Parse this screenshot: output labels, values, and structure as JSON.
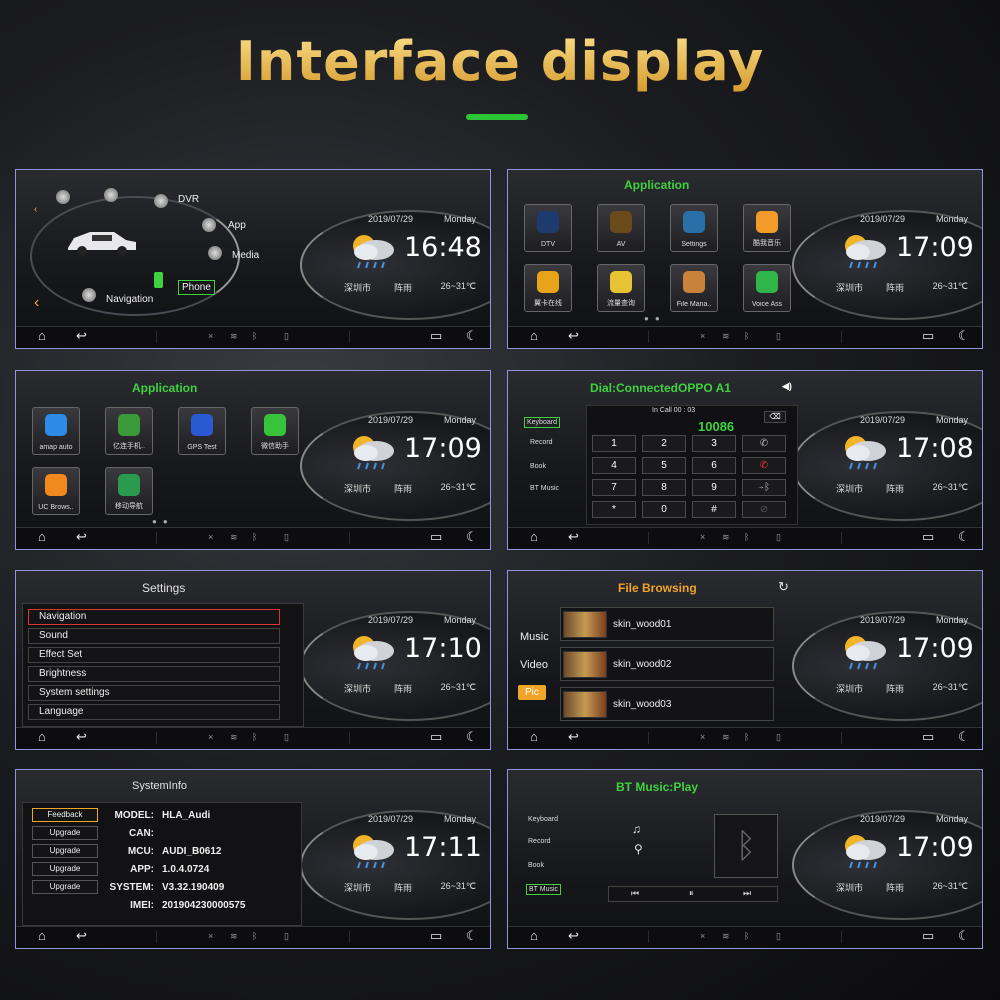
{
  "header": {
    "title": "Interface display"
  },
  "widget": {
    "date": "2019/07/29",
    "day": "Monday",
    "city": "深圳市",
    "condition": "阵雨",
    "temp": "26~31℃"
  },
  "times": [
    "16:48",
    "17:09",
    "17:09",
    "17:08",
    "17:10",
    "17:09",
    "17:11",
    "17:09"
  ],
  "home": {
    "items": {
      "dvr": "DVR",
      "app": "App",
      "media": "Media",
      "phone": "Phone",
      "navigation": "Navigation"
    }
  },
  "app1": {
    "title": "Application",
    "apps": [
      "DTV",
      "AV",
      "Settings",
      "酷我音乐",
      "翼卡在线",
      "流量查询",
      "File Mana..",
      "Voice Ass"
    ]
  },
  "app2": {
    "title": "Application",
    "apps": [
      "amap auto",
      "亿连手机..",
      "GPS Test",
      "微信助手",
      "UC Brows..",
      "移动导航"
    ]
  },
  "dial": {
    "title": "Dial:ConnectedOPPO A1",
    "status": "In Call  00 : 03",
    "number": "10086",
    "side": [
      "Keyboard",
      "Record",
      "Book",
      "BT Music"
    ],
    "keys": [
      "1",
      "2",
      "3",
      "4",
      "5",
      "6",
      "7",
      "8",
      "9",
      "*",
      "0",
      "#"
    ]
  },
  "settings": {
    "title": "Settings",
    "items": [
      "Navigation",
      "Sound",
      "Effect Set",
      "Brightness",
      "System settings",
      "Language"
    ]
  },
  "files": {
    "title": "File Browsing",
    "tabs": [
      "Music",
      "Video",
      "Pic"
    ],
    "rows": [
      "skin_wood01",
      "skin_wood02",
      "skin_wood03"
    ]
  },
  "sysinfo": {
    "title": "SystemInfo",
    "buttons": [
      "Feedback",
      "Upgrade",
      "Upgrade",
      "Upgrade",
      "Upgrade"
    ],
    "rows": [
      {
        "k": "MODEL:",
        "v": "HLA_Audi"
      },
      {
        "k": "CAN:",
        "v": ""
      },
      {
        "k": "MCU:",
        "v": "AUDI_B0612"
      },
      {
        "k": "APP:",
        "v": "1.0.4.0724"
      },
      {
        "k": "SYSTEM:",
        "v": "V3.32.190409"
      },
      {
        "k": "IMEI:",
        "v": "201904230000575"
      }
    ]
  },
  "btmusic": {
    "title": "BT Music:Play",
    "side": [
      "Keyboard",
      "Record",
      "Book",
      "BT Music"
    ]
  },
  "icons": [
    "home-icon",
    "back-icon",
    "recent-apps-icon",
    "night-mode-icon",
    "bluetooth-icon",
    "wifi-icon"
  ]
}
